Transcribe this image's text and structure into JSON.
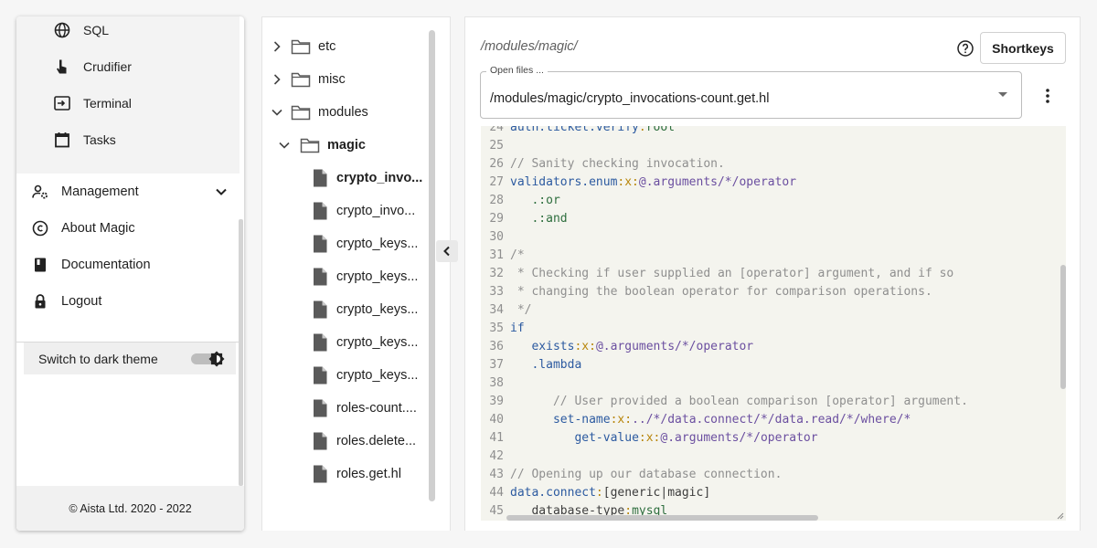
{
  "nav": {
    "sub_items": [
      {
        "label": "SQL",
        "icon": "globe-icon"
      },
      {
        "label": "Crudifier",
        "icon": "pointer-hand-icon"
      },
      {
        "label": "Terminal",
        "icon": "terminal-icon"
      },
      {
        "label": "Tasks",
        "icon": "calendar-icon"
      }
    ],
    "items": [
      {
        "label": "Management",
        "icon": "manage-accounts-icon"
      },
      {
        "label": "About Magic",
        "icon": "copyright-icon"
      },
      {
        "label": "Documentation",
        "icon": "book-icon"
      },
      {
        "label": "Logout",
        "icon": "lock-icon"
      }
    ],
    "theme_label": "Switch to dark theme",
    "footer": "© Aista Ltd. 2020 - 2022"
  },
  "tree": {
    "rows": [
      {
        "label": "etc",
        "type": "folder",
        "expanded": false
      },
      {
        "label": "misc",
        "type": "folder",
        "expanded": false
      },
      {
        "label": "modules",
        "type": "folder",
        "expanded": true
      },
      {
        "label": "magic",
        "type": "folder",
        "expanded": true
      },
      {
        "label": "crypto_invo...",
        "type": "file",
        "selected": true
      },
      {
        "label": "crypto_invo...",
        "type": "file"
      },
      {
        "label": "crypto_keys...",
        "type": "file"
      },
      {
        "label": "crypto_keys...",
        "type": "file"
      },
      {
        "label": "crypto_keys...",
        "type": "file"
      },
      {
        "label": "crypto_keys...",
        "type": "file"
      },
      {
        "label": "crypto_keys...",
        "type": "file"
      },
      {
        "label": "roles-count....",
        "type": "file"
      },
      {
        "label": "roles.delete...",
        "type": "file"
      },
      {
        "label": "roles.get.hl",
        "type": "file"
      }
    ]
  },
  "editor": {
    "folder_path": "/modules/magic/",
    "shortkeys_label": "Shortkeys",
    "open_files_label": "Open files ...",
    "open_file": "/modules/magic/crypto_invocations-count.get.hl",
    "code_lines": [
      {
        "n": "24",
        "tokens": [
          [
            "name",
            "auth.ticket.verify"
          ],
          [
            "op",
            ":"
          ],
          [
            "str",
            "root"
          ]
        ]
      },
      {
        "n": "25",
        "tokens": []
      },
      {
        "n": "26",
        "tokens": [
          [
            "com",
            "// Sanity checking invocation."
          ]
        ]
      },
      {
        "n": "27",
        "tokens": [
          [
            "name",
            "validators.enum"
          ],
          [
            "op",
            ":x:"
          ],
          [
            "val",
            "@.arguments/*/operator"
          ]
        ]
      },
      {
        "n": "28",
        "tokens": [
          [
            "plain",
            "   "
          ],
          [
            "str",
            ".:or"
          ]
        ]
      },
      {
        "n": "29",
        "tokens": [
          [
            "plain",
            "   "
          ],
          [
            "str",
            ".:and"
          ]
        ]
      },
      {
        "n": "30",
        "tokens": []
      },
      {
        "n": "31",
        "tokens": [
          [
            "com",
            "/*"
          ]
        ]
      },
      {
        "n": "32",
        "tokens": [
          [
            "com",
            " * Checking if user supplied an [operator] argument, and if so"
          ]
        ]
      },
      {
        "n": "33",
        "tokens": [
          [
            "com",
            " * changing the boolean operator for comparison operations."
          ]
        ]
      },
      {
        "n": "34",
        "tokens": [
          [
            "com",
            " */"
          ]
        ]
      },
      {
        "n": "35",
        "tokens": [
          [
            "kw",
            "if"
          ]
        ]
      },
      {
        "n": "36",
        "tokens": [
          [
            "plain",
            "   "
          ],
          [
            "name",
            "exists"
          ],
          [
            "op",
            ":x:"
          ],
          [
            "val",
            "@.arguments/*/operator"
          ]
        ]
      },
      {
        "n": "37",
        "tokens": [
          [
            "plain",
            "   "
          ],
          [
            "name",
            ".lambda"
          ]
        ]
      },
      {
        "n": "38",
        "tokens": []
      },
      {
        "n": "39",
        "tokens": [
          [
            "plain",
            "      "
          ],
          [
            "com",
            "// User provided a boolean comparison [operator] argument."
          ]
        ]
      },
      {
        "n": "40",
        "tokens": [
          [
            "plain",
            "      "
          ],
          [
            "name",
            "set-name"
          ],
          [
            "op",
            ":x:"
          ],
          [
            "val",
            "../*/data.connect/*/data.read/*/where/*"
          ]
        ]
      },
      {
        "n": "41",
        "tokens": [
          [
            "plain",
            "         "
          ],
          [
            "name",
            "get-value"
          ],
          [
            "op",
            ":x:"
          ],
          [
            "val",
            "@.arguments/*/operator"
          ]
        ]
      },
      {
        "n": "42",
        "tokens": []
      },
      {
        "n": "43",
        "tokens": [
          [
            "com",
            "// Opening up our database connection."
          ]
        ]
      },
      {
        "n": "44",
        "tokens": [
          [
            "name",
            "data.connect"
          ],
          [
            "op",
            ":"
          ],
          [
            "plain",
            "[generic|magic]"
          ]
        ]
      },
      {
        "n": "45",
        "tokens": [
          [
            "plain",
            "   database-type"
          ],
          [
            "op",
            ":"
          ],
          [
            "str",
            "mysql"
          ]
        ]
      }
    ]
  },
  "colors": {
    "code_background": "#f4f4ee",
    "name_token": "#2c5aa0",
    "value_token": "#6b4fa0",
    "string_token": "#2e6e3e",
    "comment_token": "#8f8f8f",
    "operator_token": "#b8860b"
  }
}
